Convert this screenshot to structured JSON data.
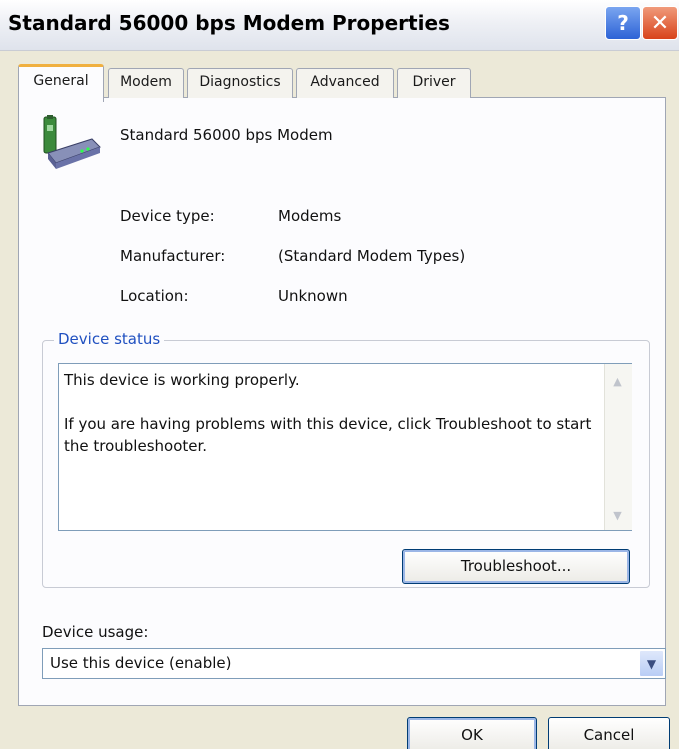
{
  "window": {
    "title": "Standard 56000 bps Modem Properties",
    "help_glyph": "?",
    "close_glyph": "✕"
  },
  "tabs": [
    {
      "label": "General",
      "active": true
    },
    {
      "label": "Modem",
      "active": false
    },
    {
      "label": "Diagnostics",
      "active": false
    },
    {
      "label": "Advanced",
      "active": false
    },
    {
      "label": "Driver",
      "active": false
    }
  ],
  "device": {
    "name": "Standard 56000 bps Modem",
    "icon": "modem-icon",
    "properties": [
      {
        "label": "Device type:",
        "value": "Modems"
      },
      {
        "label": "Manufacturer:",
        "value": "(Standard Modem Types)"
      },
      {
        "label": "Location:",
        "value": "Unknown"
      }
    ]
  },
  "status": {
    "group_title": "Device status",
    "line1": "This device is working properly.",
    "line2": "If you are having problems with this device, click Troubleshoot to start the troubleshooter.",
    "troubleshoot_label": "Troubleshoot..."
  },
  "usage": {
    "label": "Device usage:",
    "selected": "Use this device (enable)"
  },
  "buttons": {
    "ok": "OK",
    "cancel": "Cancel"
  },
  "colors": {
    "dialog_background": "#ece9d8",
    "panel_background": "#fcfcfe",
    "group_title": "#2050c0",
    "close_button": "#d8431c",
    "help_button": "#2d63d6",
    "active_tab_highlight": "#f0b040"
  }
}
